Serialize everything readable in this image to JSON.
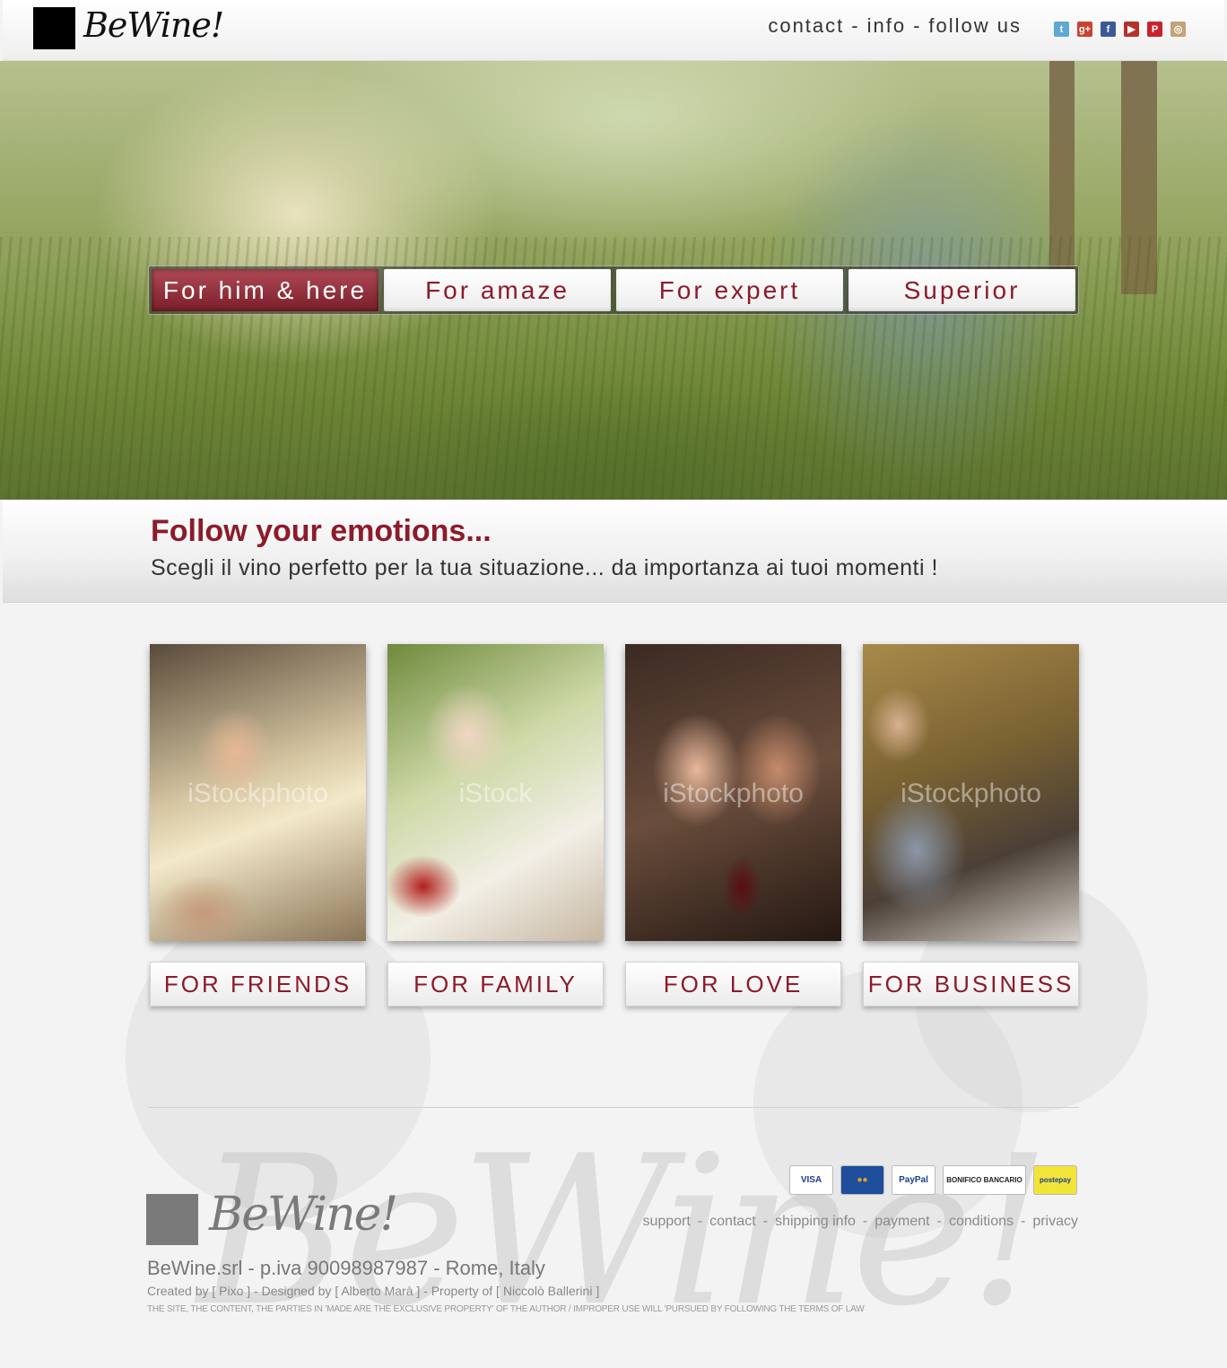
{
  "header": {
    "logo": "BeWine!",
    "nav": [
      "contact",
      "info",
      "follow us"
    ],
    "nav_separator": "-",
    "social": [
      {
        "name": "twitter-icon",
        "glyph": "t",
        "color": "#5ea9d4"
      },
      {
        "name": "google-plus-icon",
        "glyph": "g+",
        "color": "#c9432f"
      },
      {
        "name": "facebook-icon",
        "glyph": "f",
        "color": "#3b5998"
      },
      {
        "name": "youtube-icon",
        "glyph": "▶",
        "color": "#b3322a"
      },
      {
        "name": "pinterest-icon",
        "glyph": "P",
        "color": "#c8232c"
      },
      {
        "name": "instagram-icon",
        "glyph": "◎",
        "color": "#c4a27a"
      }
    ]
  },
  "hero": {
    "tabs": [
      {
        "label": "For him & here",
        "active": true
      },
      {
        "label": "For amaze",
        "active": false
      },
      {
        "label": "For expert",
        "active": false
      },
      {
        "label": "Superior",
        "active": false
      }
    ]
  },
  "tagline": {
    "title": "Follow your emotions...",
    "subtitle": "Scegli il vino perfetto per la tua situazione... da importanza ai tuoi momenti !"
  },
  "cards": [
    {
      "label": "FOR FRIENDS",
      "watermark": "iStockphoto"
    },
    {
      "label": "FOR FAMILY",
      "watermark": "iStock"
    },
    {
      "label": "FOR LOVE",
      "watermark": "iStockphoto"
    },
    {
      "label": "FOR BUSINESS",
      "watermark": "iStockphoto"
    }
  ],
  "footer": {
    "logo": "BeWine!",
    "watermark": "BeWine!",
    "payments": [
      {
        "name": "visa-icon",
        "label": "VISA",
        "bg": "#ffffff",
        "fg": "#1a3f8f"
      },
      {
        "name": "mastercard-icon",
        "label": "●●",
        "bg": "#1f4e9c",
        "fg": "#e9a21b"
      },
      {
        "name": "paypal-icon",
        "label": "PayPal",
        "bg": "#ffffff",
        "fg": "#1a3f8f"
      },
      {
        "name": "bonifico-bancario-icon",
        "label": "BONIFICO BANCARIO",
        "bg": "#ffffff",
        "fg": "#222222"
      },
      {
        "name": "postepay-icon",
        "label": "postepay",
        "bg": "#f3e43a",
        "fg": "#1a3f8f"
      }
    ],
    "links": [
      "support",
      "contact",
      "shipping info",
      "payment",
      "conditions",
      "privacy"
    ],
    "company": "BeWine.srl - p.iva 90098987987 - Rome, Italy",
    "credits": "Created by [ Pixo ] - Designed by [ Alberto Marà ] - Property of  [ Niccolò Ballerini ]",
    "legal": "THE SITE, THE CONTENT, THE PARTIES IN 'MADE ARE THE EXCLUSIVE PROPERTY' OF THE AUTHOR / IMPROPER USE WILL 'PURSUED BY FOLLOWING THE TERMS OF LAW"
  }
}
